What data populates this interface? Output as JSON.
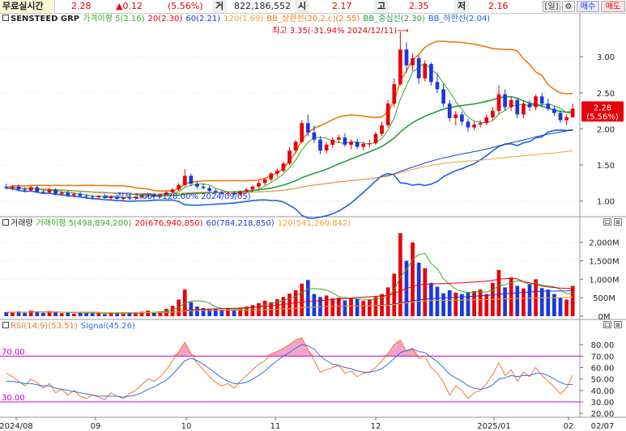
{
  "topbar": {
    "mode": "무료실시간",
    "price": "2.28",
    "change": "▲0.12",
    "change_pct": "(5.56%)",
    "volume_label": "거",
    "volume": "822,186,552",
    "open_label": "시",
    "open": "2.17",
    "high_label": "고",
    "high": "2.35",
    "low_label": "저",
    "low": "2.16",
    "period_button": "[일]",
    "settings_icon": "gear-icon",
    "buy_button": "매수",
    "sell_button": "매도"
  },
  "price_panel": {
    "legend": {
      "ticker": "SENSTEED GRP",
      "ma5": "가격이평 5(2.16)",
      "ma20": "20(2.30)",
      "ma60": "60(2.21)",
      "ma120": "120(1.69)",
      "bb_upper": "BB_상한선(20,2,c)(2.55)",
      "bb_mid": "BB_중심선(2.30)",
      "bb_lower": "BB_하한선(2.04)"
    },
    "high_annotation": "최고 3.35(-31.94% 2024/12/11)⟶",
    "low_annotation": "⟵최저 1.00(+128.00% 2024/09/05)",
    "price_tag": "2.28",
    "price_tag_pct": "(5.56%)",
    "y_ticks": [
      "3.00",
      "2.50",
      "2.00",
      "1.50",
      "1.00"
    ]
  },
  "volume_panel": {
    "legend": {
      "title": "거래량",
      "ma5": "거래이평 5(498,894,200)",
      "ma20": "20(676,940,850)",
      "ma60": "60(784,218,850)",
      "ma120": "120(541,260,842)"
    },
    "y_ticks": [
      "2,000M",
      "1,500M",
      "1,000M",
      "500M",
      "0M"
    ]
  },
  "rsi_panel": {
    "legend": {
      "rsi": "RSI(14,9)(53.51)",
      "signal": "Signal(45.26)"
    },
    "level_high": "70.00",
    "level_low": "30.00",
    "y_ticks": [
      "80.00",
      "70.00",
      "60.00",
      "50.00",
      "40.00",
      "30.00",
      "20.00"
    ]
  },
  "x_axis": {
    "labels": [
      "2024/08",
      "09",
      "10",
      "11",
      "12",
      "2025/01",
      "02"
    ],
    "last_date": "02/07"
  },
  "panel_buttons": [
    "口",
    "⊠"
  ],
  "colors": {
    "up": "#e8000b",
    "down": "#1a39d9",
    "ma5": "#3aa822",
    "ma20": "#e8000b",
    "ma60": "#1a39d9",
    "ma120": "#f0a030",
    "bb_upper": "#f07a10",
    "bb_mid": "#20a040",
    "bb_lower": "#2060e0",
    "rsi": "#f07a30",
    "signal": "#3070e0",
    "level": "#d000d0"
  },
  "chart_data": {
    "type": "candlestick",
    "price_range": [
      0.85,
      3.45
    ],
    "volume_range_millions": [
      0,
      2300
    ],
    "rsi_range": [
      18,
      90
    ],
    "candles": [
      [
        1.2,
        1.24,
        1.16,
        1.18
      ],
      [
        1.18,
        1.22,
        1.15,
        1.2
      ],
      [
        1.2,
        1.23,
        1.14,
        1.16
      ],
      [
        1.16,
        1.19,
        1.12,
        1.15
      ],
      [
        1.15,
        1.21,
        1.13,
        1.19
      ],
      [
        1.19,
        1.22,
        1.12,
        1.13
      ],
      [
        1.13,
        1.16,
        1.1,
        1.12
      ],
      [
        1.12,
        1.18,
        1.1,
        1.16
      ],
      [
        1.16,
        1.18,
        1.08,
        1.1
      ],
      [
        1.1,
        1.14,
        1.07,
        1.12
      ],
      [
        1.12,
        1.15,
        1.06,
        1.08
      ],
      [
        1.08,
        1.12,
        1.05,
        1.1
      ],
      [
        1.1,
        1.13,
        1.05,
        1.07
      ],
      [
        1.07,
        1.1,
        1.03,
        1.06
      ],
      [
        1.06,
        1.09,
        1.02,
        1.05
      ],
      [
        1.05,
        1.08,
        1.02,
        1.07
      ],
      [
        1.07,
        1.1,
        1.03,
        1.04
      ],
      [
        1.04,
        1.08,
        1.01,
        1.06
      ],
      [
        1.06,
        1.09,
        1.02,
        1.03
      ],
      [
        1.03,
        1.06,
        1.0,
        1.05
      ],
      [
        1.05,
        1.09,
        1.02,
        1.04
      ],
      [
        1.04,
        1.07,
        1.02,
        1.06
      ],
      [
        1.06,
        1.1,
        1.04,
        1.08
      ],
      [
        1.08,
        1.12,
        1.05,
        1.09
      ],
      [
        1.09,
        1.11,
        1.05,
        1.06
      ],
      [
        1.06,
        1.1,
        1.04,
        1.09
      ],
      [
        1.09,
        1.14,
        1.07,
        1.12
      ],
      [
        1.12,
        1.18,
        1.1,
        1.16
      ],
      [
        1.16,
        1.25,
        1.14,
        1.22
      ],
      [
        1.22,
        1.44,
        1.2,
        1.35
      ],
      [
        1.35,
        1.38,
        1.2,
        1.24
      ],
      [
        1.24,
        1.27,
        1.17,
        1.2
      ],
      [
        1.2,
        1.24,
        1.16,
        1.18
      ],
      [
        1.18,
        1.21,
        1.12,
        1.14
      ],
      [
        1.14,
        1.17,
        1.1,
        1.12
      ],
      [
        1.12,
        1.15,
        1.08,
        1.1
      ],
      [
        1.1,
        1.13,
        1.07,
        1.11
      ],
      [
        1.11,
        1.14,
        1.08,
        1.09
      ],
      [
        1.09,
        1.15,
        1.07,
        1.13
      ],
      [
        1.13,
        1.18,
        1.1,
        1.16
      ],
      [
        1.16,
        1.22,
        1.13,
        1.2
      ],
      [
        1.2,
        1.28,
        1.18,
        1.25
      ],
      [
        1.25,
        1.32,
        1.22,
        1.3
      ],
      [
        1.3,
        1.4,
        1.27,
        1.38
      ],
      [
        1.38,
        1.45,
        1.33,
        1.42
      ],
      [
        1.42,
        1.55,
        1.4,
        1.52
      ],
      [
        1.52,
        1.75,
        1.5,
        1.7
      ],
      [
        1.7,
        1.85,
        1.66,
        1.82
      ],
      [
        1.82,
        2.12,
        1.8,
        2.08
      ],
      [
        2.08,
        2.2,
        1.9,
        1.95
      ],
      [
        1.95,
        2.05,
        1.8,
        1.85
      ],
      [
        1.85,
        1.9,
        1.65,
        1.7
      ],
      [
        1.7,
        1.82,
        1.66,
        1.78
      ],
      [
        1.78,
        1.88,
        1.74,
        1.85
      ],
      [
        1.85,
        1.92,
        1.8,
        1.88
      ],
      [
        1.88,
        1.94,
        1.75,
        1.78
      ],
      [
        1.78,
        1.85,
        1.72,
        1.82
      ],
      [
        1.82,
        1.86,
        1.72,
        1.75
      ],
      [
        1.75,
        1.82,
        1.7,
        1.79
      ],
      [
        1.79,
        1.85,
        1.74,
        1.8
      ],
      [
        1.8,
        1.96,
        1.78,
        1.93
      ],
      [
        1.93,
        2.1,
        1.9,
        2.05
      ],
      [
        2.05,
        2.4,
        2.02,
        2.35
      ],
      [
        2.35,
        2.7,
        2.3,
        2.62
      ],
      [
        2.62,
        3.35,
        2.6,
        3.1
      ],
      [
        3.1,
        3.2,
        2.78,
        2.88
      ],
      [
        2.88,
        3.05,
        2.8,
        2.98
      ],
      [
        2.98,
        3.02,
        2.62,
        2.7
      ],
      [
        2.7,
        2.95,
        2.66,
        2.9
      ],
      [
        2.9,
        2.92,
        2.6,
        2.65
      ],
      [
        2.65,
        2.78,
        2.5,
        2.55
      ],
      [
        2.55,
        2.62,
        2.3,
        2.35
      ],
      [
        2.35,
        2.4,
        2.1,
        2.15
      ],
      [
        2.15,
        2.25,
        2.05,
        2.2
      ],
      [
        2.2,
        2.24,
        2.05,
        2.1
      ],
      [
        2.1,
        2.14,
        1.96,
        2.02
      ],
      [
        2.02,
        2.1,
        1.98,
        2.06
      ],
      [
        2.06,
        2.12,
        2.02,
        2.08
      ],
      [
        2.08,
        2.2,
        2.05,
        2.16
      ],
      [
        2.16,
        2.3,
        2.12,
        2.25
      ],
      [
        2.25,
        2.6,
        2.2,
        2.48
      ],
      [
        2.48,
        2.55,
        2.25,
        2.3
      ],
      [
        2.3,
        2.45,
        2.25,
        2.4
      ],
      [
        2.4,
        2.43,
        2.15,
        2.2
      ],
      [
        2.2,
        2.38,
        2.15,
        2.35
      ],
      [
        2.35,
        2.4,
        2.25,
        2.3
      ],
      [
        2.3,
        2.48,
        2.26,
        2.45
      ],
      [
        2.45,
        2.5,
        2.3,
        2.35
      ],
      [
        2.35,
        2.42,
        2.25,
        2.28
      ],
      [
        2.28,
        2.32,
        2.18,
        2.22
      ],
      [
        2.22,
        2.26,
        2.08,
        2.12
      ],
      [
        2.12,
        2.2,
        2.05,
        2.16
      ],
      [
        2.16,
        2.35,
        2.16,
        2.28
      ]
    ],
    "volume_millions": [
      110,
      95,
      130,
      85,
      150,
      120,
      90,
      140,
      100,
      80,
      95,
      70,
      110,
      85,
      75,
      90,
      60,
      100,
      80,
      70,
      90,
      80,
      120,
      150,
      95,
      130,
      200,
      280,
      450,
      720,
      380,
      260,
      220,
      190,
      200,
      180,
      210,
      170,
      230,
      260,
      300,
      350,
      420,
      380,
      460,
      520,
      610,
      700,
      880,
      980,
      600,
      520,
      560,
      480,
      500,
      430,
      480,
      460,
      420,
      450,
      520,
      600,
      780,
      1150,
      2250,
      1500,
      2000,
      1450,
      1300,
      900,
      800,
      620,
      700,
      640,
      600,
      650,
      680,
      720,
      600,
      900,
      1250,
      780,
      1050,
      820,
      750,
      880,
      1000,
      760,
      720,
      600,
      510,
      450,
      820
    ],
    "rsi": [
      55,
      52,
      48,
      44,
      50,
      47,
      42,
      46,
      38,
      41,
      36,
      40,
      35,
      33,
      36,
      34,
      32,
      38,
      35,
      33,
      37,
      40,
      45,
      50,
      48,
      52,
      58,
      66,
      74,
      82,
      72,
      64,
      58,
      52,
      47,
      44,
      46,
      42,
      48,
      53,
      58,
      63,
      66,
      72,
      74,
      77,
      80,
      84,
      86,
      76,
      66,
      56,
      58,
      60,
      62,
      55,
      57,
      52,
      55,
      56,
      60,
      66,
      72,
      80,
      84,
      74,
      77,
      68,
      70,
      60,
      55,
      47,
      36,
      44,
      40,
      33,
      38,
      40,
      46,
      54,
      64,
      53,
      58,
      48,
      56,
      52,
      60,
      53,
      48,
      43,
      37,
      42,
      53.51
    ],
    "signal": [
      48,
      48,
      47,
      46,
      46,
      45,
      44,
      44,
      42,
      41,
      40,
      39,
      38,
      37,
      36,
      35,
      35,
      35,
      35,
      34,
      35,
      36,
      38,
      41,
      43,
      46,
      49,
      54,
      60,
      66,
      68,
      66,
      63,
      59,
      55,
      51,
      48,
      46,
      46,
      47,
      50,
      53,
      57,
      62,
      66,
      70,
      73,
      77,
      80,
      79,
      76,
      70,
      66,
      63,
      62,
      60,
      59,
      57,
      56,
      56,
      57,
      59,
      63,
      68,
      73,
      75,
      76,
      74,
      73,
      69,
      65,
      60,
      54,
      51,
      48,
      44,
      42,
      41,
      42,
      45,
      50,
      51,
      53,
      52,
      53,
      53,
      55,
      55,
      53,
      50,
      47,
      45,
      45.26
    ]
  }
}
